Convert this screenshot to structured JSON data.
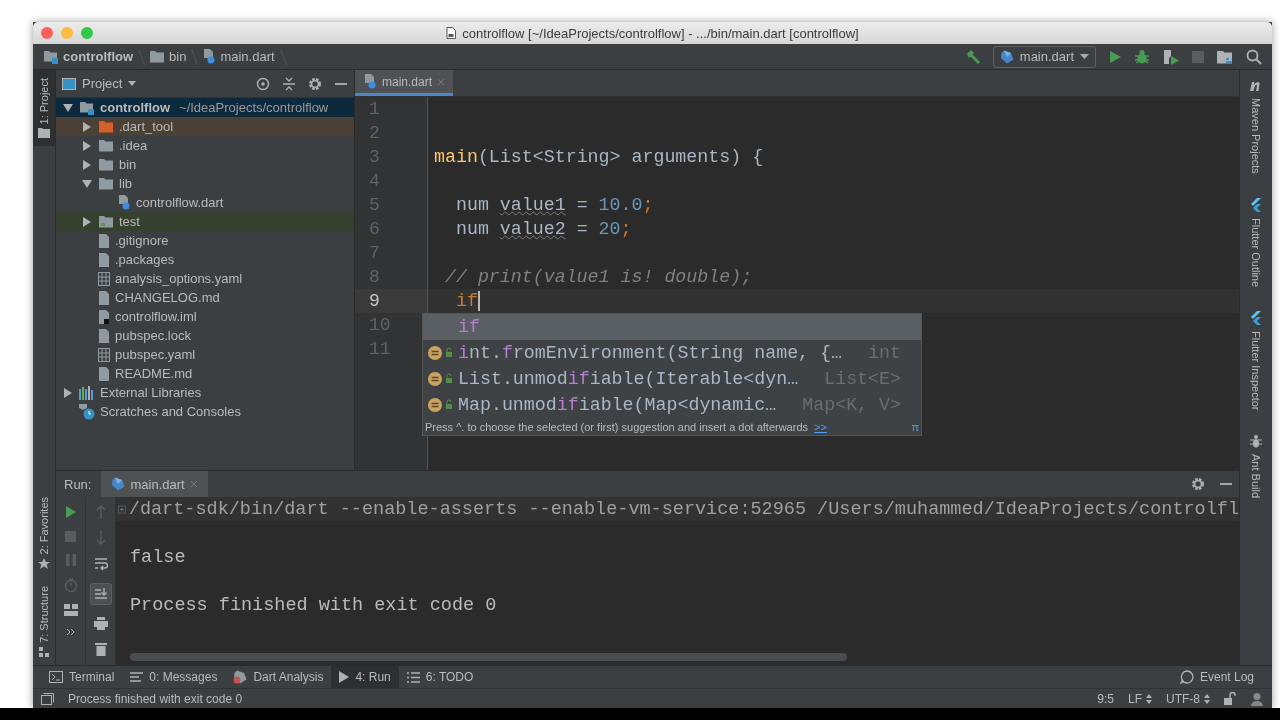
{
  "title_bar": {
    "title": "controlflow [~/IdeaProjects/controlflow] - .../bin/main.dart [controlflow]"
  },
  "navbar": {
    "breadcrumbs": [
      {
        "label": "controlflow",
        "kind": "module"
      },
      {
        "label": "bin",
        "kind": "folder"
      },
      {
        "label": "main.dart",
        "kind": "dart"
      }
    ],
    "run_config": "main.dart"
  },
  "left_stripe_top": [
    {
      "label": "1: Project",
      "selected": true
    }
  ],
  "left_stripe_bottom": [
    {
      "label": "2: Favorites",
      "selected": false
    },
    {
      "label": "7: Structure",
      "selected": false
    }
  ],
  "right_stripe": [
    {
      "label": "Maven Projects",
      "kind": "maven"
    },
    {
      "label": "Flutter Outline",
      "kind": "flutter"
    },
    {
      "label": "Flutter Inspector",
      "kind": "flutter"
    },
    {
      "label": "Ant Build",
      "kind": "ant"
    }
  ],
  "project_panel": {
    "title": "Project",
    "tree": [
      {
        "label": "controlflow",
        "path": "~/IdeaProjects/controlflow",
        "kind": "module",
        "expanded": true,
        "selected": true,
        "children": [
          {
            "label": ".dart_tool",
            "kind": "folder-excluded",
            "expanded": false,
            "selected": false
          },
          {
            "label": ".idea",
            "kind": "folder",
            "expanded": false,
            "selected": false
          },
          {
            "label": "bin",
            "kind": "folder",
            "expanded": false,
            "selected": false
          },
          {
            "label": "lib",
            "kind": "folder",
            "expanded": true,
            "selected": false,
            "children": [
              {
                "label": "controlflow.dart",
                "kind": "dart",
                "selected": false
              }
            ]
          },
          {
            "label": "test",
            "kind": "folder-test",
            "expanded": false,
            "selected": false
          },
          {
            "label": ".gitignore",
            "kind": "file",
            "selected": false
          },
          {
            "label": ".packages",
            "kind": "file",
            "selected": false
          },
          {
            "label": "analysis_options.yaml",
            "kind": "yaml",
            "selected": false
          },
          {
            "label": "CHANGELOG.md",
            "kind": "file",
            "selected": false
          },
          {
            "label": "controlflow.iml",
            "kind": "iml",
            "selected": false
          },
          {
            "label": "pubspec.lock",
            "kind": "file",
            "selected": false
          },
          {
            "label": "pubspec.yaml",
            "kind": "yaml",
            "selected": false
          },
          {
            "label": "README.md",
            "kind": "file",
            "selected": false
          }
        ]
      },
      {
        "label": "External Libraries",
        "kind": "libraries",
        "expanded": false,
        "selected": false
      },
      {
        "label": "Scratches and Consoles",
        "kind": "scratches",
        "selected": false
      }
    ]
  },
  "editor": {
    "tabs": [
      {
        "label": "main.dart",
        "selected": true
      }
    ],
    "lines": [
      {
        "number": "1",
        "current": false
      },
      {
        "number": "2",
        "current": false
      },
      {
        "number": "3",
        "current": false,
        "tokens": [
          {
            "text": "main",
            "kind": "function"
          },
          {
            "text": "(List<String> arguments) {",
            "kind": "plain"
          }
        ]
      },
      {
        "number": "4",
        "current": false
      },
      {
        "number": "5",
        "current": false,
        "tokens": [
          {
            "text": "  num ",
            "kind": "plain"
          },
          {
            "text": "value1",
            "kind": "unused"
          },
          {
            "text": " = ",
            "kind": "plain"
          },
          {
            "text": "10.0",
            "kind": "number"
          },
          {
            "text": ";",
            "kind": "keyword"
          }
        ]
      },
      {
        "number": "6",
        "current": false,
        "tokens": [
          {
            "text": "  num ",
            "kind": "plain"
          },
          {
            "text": "value2",
            "kind": "unused"
          },
          {
            "text": " = ",
            "kind": "plain"
          },
          {
            "text": "20",
            "kind": "number"
          },
          {
            "text": ";",
            "kind": "keyword"
          }
        ]
      },
      {
        "number": "7",
        "current": false
      },
      {
        "number": "8",
        "current": false,
        "tokens": [
          {
            "text": " // print(value1 is! double);",
            "kind": "comment"
          }
        ]
      },
      {
        "number": "9",
        "current": true,
        "tokens": [
          {
            "text": "  if",
            "kind": "keyword"
          }
        ]
      },
      {
        "number": "10",
        "current": false
      },
      {
        "number": "11",
        "current": false
      }
    ]
  },
  "completion": {
    "items": [
      {
        "kind": "keyword",
        "selected": true,
        "parts": [
          {
            "text": "if",
            "match": true
          }
        ]
      },
      {
        "kind": "method",
        "selected": false,
        "parts": [
          {
            "text": "i",
            "match": true
          },
          {
            "text": "nt.",
            "match": false
          },
          {
            "text": "f",
            "match": true
          },
          {
            "text": "romEnvironment(String name, {…",
            "match": false
          }
        ],
        "type": "int"
      },
      {
        "kind": "method",
        "selected": false,
        "parts": [
          {
            "text": "List.unmod",
            "match": false
          },
          {
            "text": "if",
            "match": true
          },
          {
            "text": "iable(Iterable<dyn…",
            "match": false
          }
        ],
        "type": "List<E>"
      },
      {
        "kind": "method",
        "selected": false,
        "parts": [
          {
            "text": "Map.unmod",
            "match": false
          },
          {
            "text": "if",
            "match": true
          },
          {
            "text": "iable(Map<dynamic…",
            "match": false
          }
        ],
        "type": "Map<K, V>"
      }
    ],
    "hint": "Press ^. to choose the selected (or first) suggestion and insert a dot afterwards",
    "link": ">>",
    "corner": "π"
  },
  "run_panel": {
    "label": "Run:",
    "tab": "main.dart",
    "output": [
      {
        "text": "/dart-sdk/bin/dart --enable-asserts --enable-vm-service:52965 /Users/muhammed/IdeaProjects/controlfl",
        "kind": "command"
      },
      {
        "text": "false",
        "kind": "output"
      },
      {
        "text": "Process finished with exit code 0",
        "kind": "output"
      }
    ]
  },
  "tool_tabs": [
    {
      "label": "Terminal",
      "kind": "terminal",
      "selected": false
    },
    {
      "label": "0: Messages",
      "kind": "messages",
      "selected": false
    },
    {
      "label": "Dart Analysis",
      "kind": "analysis",
      "selected": false
    },
    {
      "label": "4: Run",
      "kind": "run",
      "selected": true
    },
    {
      "label": "6: TODO",
      "kind": "todo",
      "selected": false
    }
  ],
  "event_log": "Event Log",
  "status_bar": {
    "message": "Process finished with exit code 0",
    "position": "9:5",
    "line_separator": "LF",
    "encoding": "UTF-8"
  }
}
